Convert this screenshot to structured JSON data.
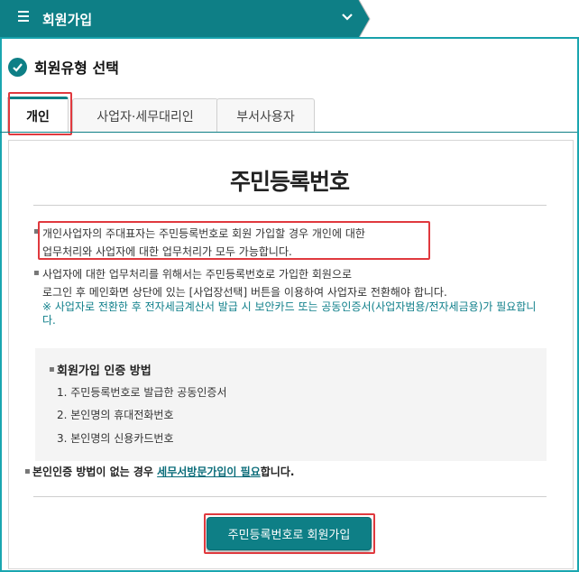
{
  "header": {
    "menu_icon": "hamburger-menu-icon",
    "title": "회원가입",
    "dropdown_icon": "chevron-down-icon",
    "accent_color": "#0e7f86"
  },
  "section": {
    "icon": "check-circle-icon",
    "title": "회원유형 선택"
  },
  "tabs": [
    {
      "label": "개인",
      "active": true
    },
    {
      "label": "사업자·세무대리인",
      "active": false
    },
    {
      "label": "부서사용자",
      "active": false
    }
  ],
  "content": {
    "title": "주민등록번호",
    "note1_line1": "개인사업자의 주대표자는 주민등록번호로 회원 가입할 경우 개인에 대한",
    "note1_line2": "업무처리와 사업자에 대한 업무처리가 모두 가능합니다.",
    "note2_line1": "사업자에 대한 업무처리를 위해서는 주민등록번호로 가입한 회원으로",
    "note2_line2": "로그인 후 메인화면 상단에 있는 [사업장선택] 버튼을 이용하여 사업자로 전환해야 합니다.",
    "warning": "※ 사업자로 전환한 후 전자세금계산서 발급 시 보안카드 또는 공동인증서(사업자범용/전자세금용)가 필요합니다.",
    "auth": {
      "title": "회원가입 인증 방법",
      "items": [
        "1. 주민등록번호로 발급한 공동인증서",
        "2. 본인명의 휴대전화번호",
        "3. 본인명의 신용카드번호"
      ]
    },
    "bottom_prefix": "본인인증 방법이 없는 경우 ",
    "bottom_link": "세무서방문가입이 필요",
    "bottom_suffix": "합니다.",
    "join_button": "주민등록번호로 회원가입"
  }
}
